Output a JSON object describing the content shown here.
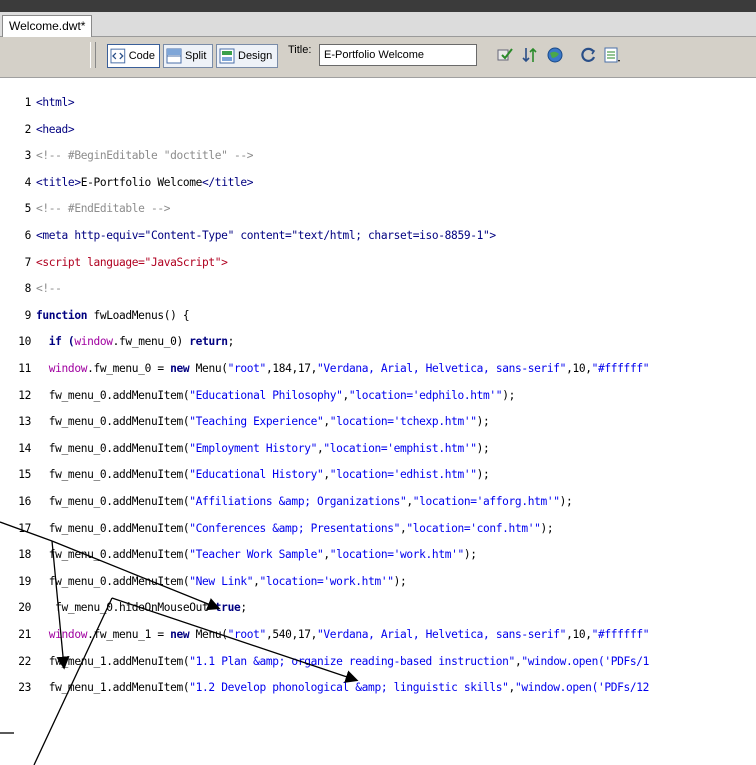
{
  "document": {
    "tab_label": "Welcome.dwt*"
  },
  "toolbar": {
    "code_label": "Code",
    "split_label": "Split",
    "design_label": "Design",
    "title_label": "Title:",
    "title_value": "E-Portfolio Welcome"
  },
  "colors": {
    "tag": "#000080",
    "comment": "#8c8c8c",
    "string": "#0000ee",
    "keyword": "#000080",
    "object": "#a000a0"
  },
  "code_lines": [
    {
      "n": "1",
      "segs": [
        [
          "tag",
          "<html>"
        ]
      ]
    },
    {
      "n": "2",
      "segs": [
        [
          "tag",
          "<head>"
        ]
      ]
    },
    {
      "n": "3",
      "segs": [
        [
          "cmt",
          "<!-- #BeginEditable \"doctitle\" -->"
        ]
      ]
    },
    {
      "n": "4",
      "segs": [
        [
          "tag",
          "<title>"
        ],
        [
          "fn",
          "E-Portfolio Welcome"
        ],
        [
          "tag",
          "</title>"
        ]
      ]
    },
    {
      "n": "5",
      "segs": [
        [
          "cmt",
          "<!-- #EndEditable -->"
        ]
      ]
    },
    {
      "n": "6",
      "segs": [
        [
          "tag",
          "<meta http-equiv=\"Content-Type\" content=\"text/html; charset=iso-8859-1\">"
        ]
      ]
    },
    {
      "n": "7",
      "segs": [
        [
          "red",
          "<script language=\"JavaScript\">"
        ]
      ]
    },
    {
      "n": "8",
      "segs": [
        [
          "cmt",
          "<!--"
        ]
      ]
    },
    {
      "n": "9",
      "segs": [
        [
          "kw",
          "function"
        ],
        [
          "fn",
          " fwLoadMenus() {"
        ]
      ]
    },
    {
      "n": "10",
      "segs": [
        [
          "kw",
          "  if ("
        ],
        [
          "obj",
          "window"
        ],
        [
          "fn",
          ".fw_menu_0) "
        ],
        [
          "kw",
          "return"
        ],
        [
          "fn",
          ";"
        ]
      ]
    },
    {
      "n": "11",
      "segs": [
        [
          "obj",
          "  window"
        ],
        [
          "fn",
          ".fw_menu_0 = "
        ],
        [
          "kw",
          "new"
        ],
        [
          "fn",
          " Menu("
        ],
        [
          "str",
          "\"root\""
        ],
        [
          "fn",
          ",184,17,"
        ],
        [
          "str",
          "\"Verdana, Arial, Helvetica, sans-serif\""
        ],
        [
          "fn",
          ",10,"
        ],
        [
          "str",
          "\"#ffffff\""
        ]
      ]
    },
    {
      "n": "12",
      "segs": [
        [
          "fn",
          "  fw_menu_0.addMenuItem("
        ],
        [
          "str",
          "\"Educational Philosophy\""
        ],
        [
          "fn",
          ","
        ],
        [
          "str",
          "\"location='edphilo.htm'\""
        ],
        [
          "fn",
          ");"
        ]
      ]
    },
    {
      "n": "13",
      "segs": [
        [
          "fn",
          "  fw_menu_0.addMenuItem("
        ],
        [
          "str",
          "\"Teaching Experience\""
        ],
        [
          "fn",
          ","
        ],
        [
          "str",
          "\"location='tchexp.htm'\""
        ],
        [
          "fn",
          ");"
        ]
      ]
    },
    {
      "n": "14",
      "segs": [
        [
          "fn",
          "  fw_menu_0.addMenuItem("
        ],
        [
          "str",
          "\"Employment History\""
        ],
        [
          "fn",
          ","
        ],
        [
          "str",
          "\"location='emphist.htm'\""
        ],
        [
          "fn",
          ");"
        ]
      ]
    },
    {
      "n": "15",
      "segs": [
        [
          "fn",
          "  fw_menu_0.addMenuItem("
        ],
        [
          "str",
          "\"Educational History\""
        ],
        [
          "fn",
          ","
        ],
        [
          "str",
          "\"location='edhist.htm'\""
        ],
        [
          "fn",
          ");"
        ]
      ]
    },
    {
      "n": "16",
      "segs": [
        [
          "fn",
          "  fw_menu_0.addMenuItem("
        ],
        [
          "str",
          "\"Affiliations &amp; Organizations\""
        ],
        [
          "fn",
          ","
        ],
        [
          "str",
          "\"location='afforg.htm'\""
        ],
        [
          "fn",
          ");"
        ]
      ]
    },
    {
      "n": "17",
      "segs": [
        [
          "fn",
          "  fw_menu_0.addMenuItem("
        ],
        [
          "str",
          "\"Conferences &amp; Presentations\""
        ],
        [
          "fn",
          ","
        ],
        [
          "str",
          "\"location='conf.htm'\""
        ],
        [
          "fn",
          ");"
        ]
      ]
    },
    {
      "n": "18",
      "segs": [
        [
          "fn",
          "  fw_menu_0.addMenuItem("
        ],
        [
          "str",
          "\"Teacher Work Sample\""
        ],
        [
          "fn",
          ","
        ],
        [
          "str",
          "\"location='work.htm'\""
        ],
        [
          "fn",
          ");"
        ]
      ]
    },
    {
      "n": "19",
      "segs": [
        [
          "fn",
          "  fw_menu_0.addMenuItem("
        ],
        [
          "str",
          "\"New Link\""
        ],
        [
          "fn",
          ","
        ],
        [
          "str",
          "\"location='work.htm'\""
        ],
        [
          "fn",
          ");"
        ]
      ]
    },
    {
      "n": "20",
      "segs": [
        [
          "fn",
          "   fw_menu_0.hideOnMouseOut="
        ],
        [
          "kw",
          "true"
        ],
        [
          "fn",
          ";"
        ]
      ]
    },
    {
      "n": "21",
      "segs": [
        [
          "obj",
          "  window"
        ],
        [
          "fn",
          ".fw_menu_1 = "
        ],
        [
          "kw",
          "new"
        ],
        [
          "fn",
          " Menu("
        ],
        [
          "str",
          "\"root\""
        ],
        [
          "fn",
          ",540,17,"
        ],
        [
          "str",
          "\"Verdana, Arial, Helvetica, sans-serif\""
        ],
        [
          "fn",
          ",10,"
        ],
        [
          "str",
          "\"#ffffff\""
        ]
      ]
    },
    {
      "n": "22",
      "segs": [
        [
          "fn",
          "  fw_menu_1.addMenuItem("
        ],
        [
          "str",
          "\"1.1 Plan &amp; organize reading-based instruction\""
        ],
        [
          "fn",
          ","
        ],
        [
          "str",
          "\"window.open('PDFs/1"
        ]
      ]
    },
    {
      "n": "23",
      "segs": [
        [
          "fn",
          "  fw_menu_1.addMenuItem("
        ],
        [
          "str",
          "\"1.2 Develop phonological &amp; linguistic skills\""
        ],
        [
          "fn",
          ","
        ],
        [
          "str",
          "\"window.open('PDFs/12"
        ]
      ]
    }
  ]
}
